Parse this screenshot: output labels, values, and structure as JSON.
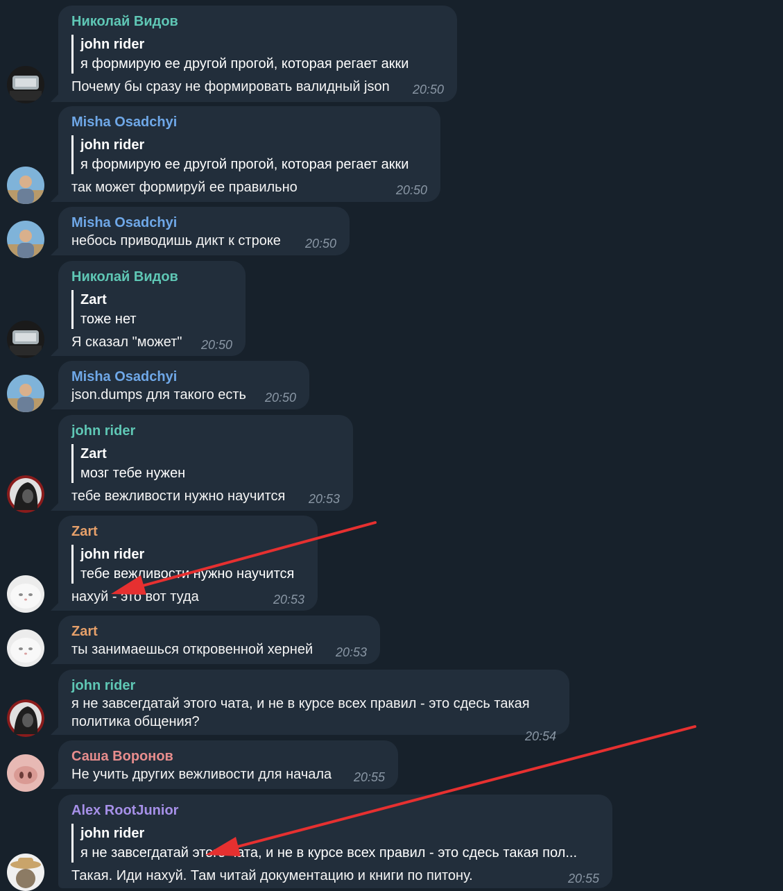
{
  "colors": {
    "background": "#17212b",
    "bubble": "#222e3b",
    "time": "#8a97a5",
    "name_teal": "#5fc7b5",
    "name_blue": "#6fa8e8",
    "name_orange": "#e6a06a",
    "name_pink": "#e88d8d",
    "name_purple": "#a690e8",
    "arrow": "#e63030"
  },
  "messages": [
    {
      "sender": "Николай Видов",
      "reply_name": "john rider",
      "reply_text": "я формирую ее другой прогой, которая регает акки",
      "text": "Почему бы сразу не формировать валидный json",
      "time": "20:50"
    },
    {
      "sender": "Misha Osadchyi",
      "reply_name": "john rider",
      "reply_text": "я формирую ее другой прогой, которая регает акки",
      "text": "так может формируй ее правильно",
      "time": "20:50"
    },
    {
      "sender": "Misha Osadchyi",
      "text": "небось приводишь дикт к строке",
      "time": "20:50"
    },
    {
      "sender": "Николай Видов",
      "reply_name": "Zart",
      "reply_text": "тоже нет",
      "text": "Я сказал \"может\"",
      "time": "20:50"
    },
    {
      "sender": "Misha Osadchyi",
      "text": "json.dumps для такого есть",
      "time": "20:50"
    },
    {
      "sender": "john rider",
      "reply_name": "Zart",
      "reply_text": "мозг тебе нужен",
      "text": "тебе вежливости нужно научится",
      "time": "20:53"
    },
    {
      "sender": "Zart",
      "reply_name": "john rider",
      "reply_text": "тебе вежливости нужно научится",
      "text": "нахуй - это вот туда",
      "time": "20:53"
    },
    {
      "sender": "Zart",
      "text": "ты занимаешься откровенной херней",
      "time": "20:53"
    },
    {
      "sender": "john rider",
      "text": "я не завсегдатай этого чата, и не в курсе всех правил - это сдесь такая политика общения?",
      "time": "20:54"
    },
    {
      "sender": "Саша Воронов",
      "text": "Не учить других вежливости для начала",
      "time": "20:55"
    },
    {
      "sender": "Alex RootJunior",
      "reply_name": "john rider",
      "reply_text": "я не завсегдатай этого чата, и не в курсе всех правил - это сдесь такая пол...",
      "text": "Такая. Иди нахуй. Там читай документацию и книги по питону.",
      "time": "20:55"
    }
  ]
}
